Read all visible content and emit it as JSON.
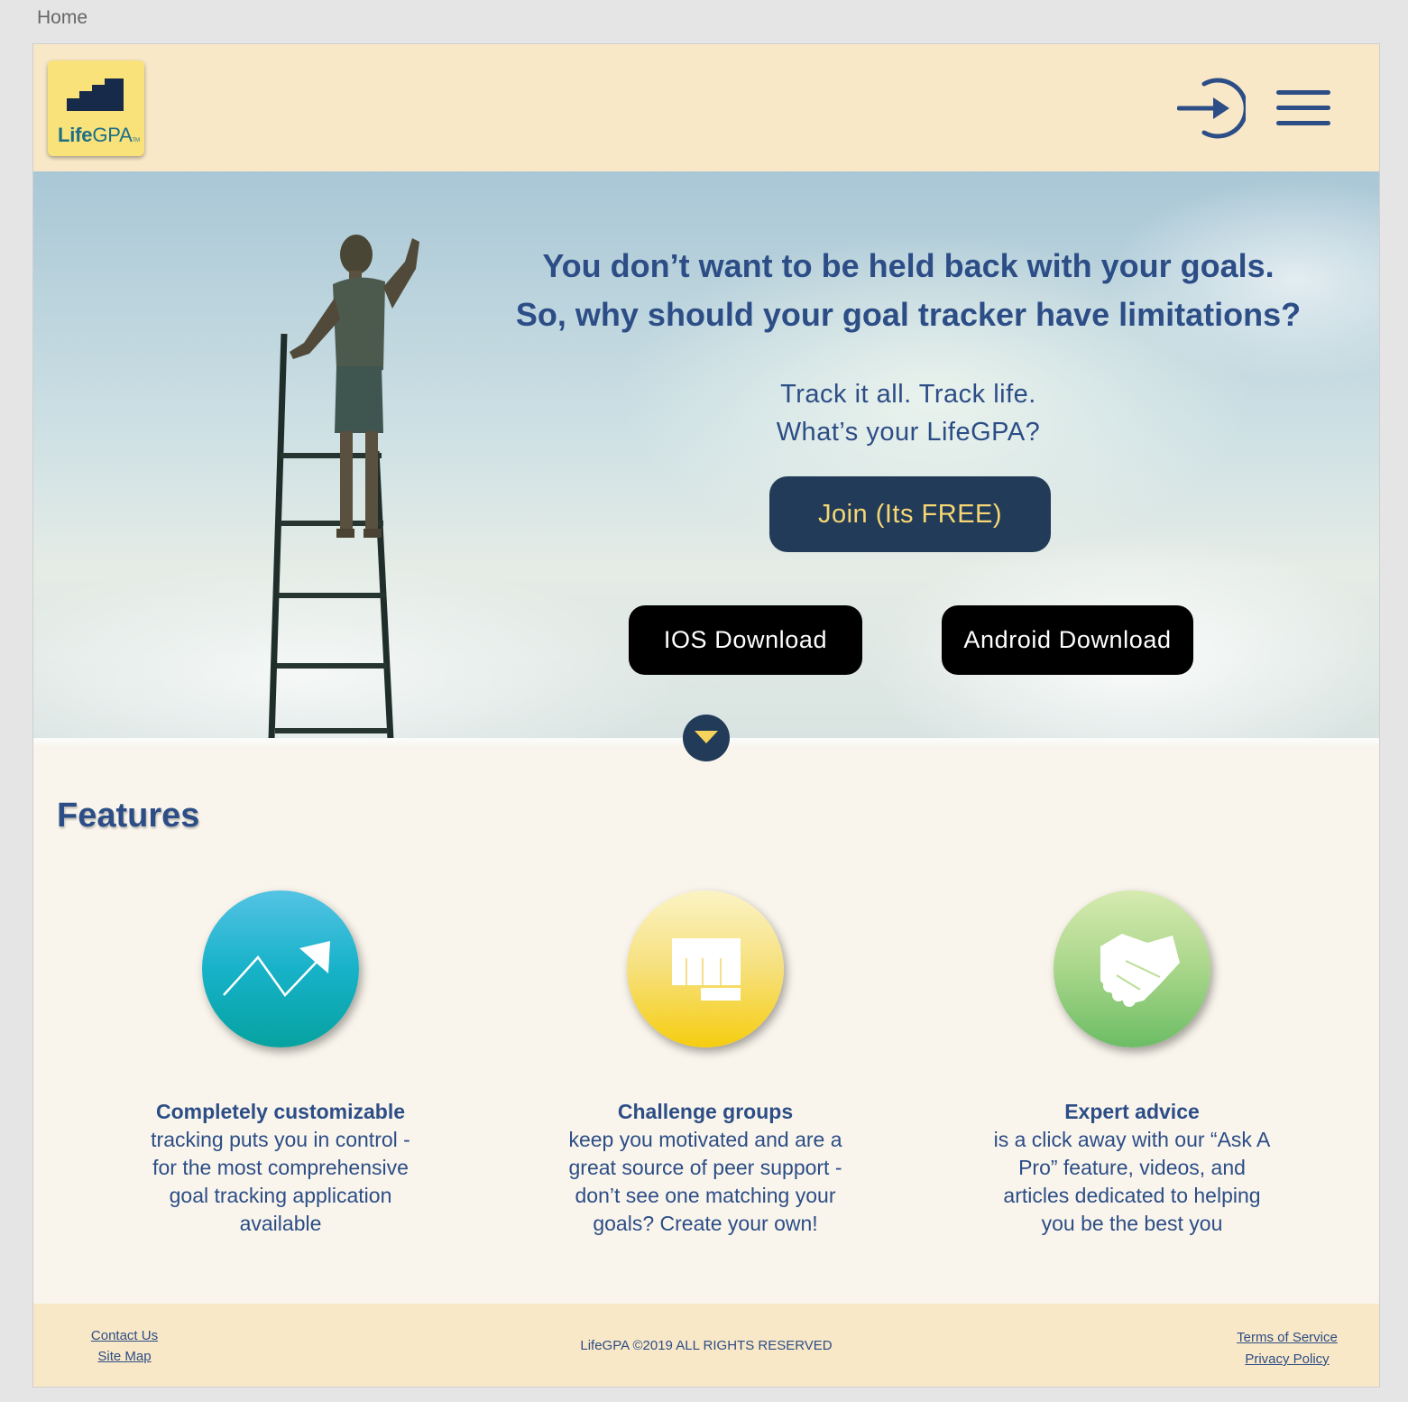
{
  "artboard": {
    "label": "Home"
  },
  "header": {
    "logo": {
      "brand_bold": "Life",
      "brand_light": "GPA",
      "trademark": "TM"
    },
    "login_icon": "sign-in-arrow",
    "menu_icon": "hamburger-menu"
  },
  "hero": {
    "headline_line1": "You don’t want to be held back with your goals.",
    "headline_line2": "So, why should your goal tracker have limitations?",
    "tagline_line1": "Track it all. Track life.",
    "tagline_line2": "What’s your LifeGPA?",
    "join_button": "Join (Its FREE)",
    "ios_button": "IOS Download",
    "android_button": "Android Download",
    "scroll_icon": "chevron-down"
  },
  "features": {
    "title": "Features",
    "items": [
      {
        "title": "Completely customizable",
        "description": "tracking puts you in control - for the most comprehensive goal tracking application available",
        "icon": "trend-arrow-icon",
        "color": "#17b2c9"
      },
      {
        "title": "Challenge groups",
        "description": "keep you motivated and are a great source of peer support - don’t see one matching your goals? Create your own!",
        "icon": "fist-icon",
        "color": "#f6cd0f"
      },
      {
        "title": "Expert advice",
        "description": "is a click away with our “Ask A Pro” feature, videos, and articles dedicated to helping you be the best you",
        "icon": "handshake-icon",
        "color": "#6cbd65"
      }
    ]
  },
  "footer": {
    "contact_us": "Contact Us",
    "site_map": "Site Map",
    "copyright": "LifeGPA ©2019 ALL RIGHTS RESERVED",
    "terms": "Terms of Service",
    "privacy": "Privacy Policy"
  },
  "colors": {
    "header_bg": "#f9e8c7",
    "primary_text": "#2c4d86",
    "join_bg": "#223b58",
    "join_text": "#f6d774",
    "download_bg": "#000000"
  }
}
